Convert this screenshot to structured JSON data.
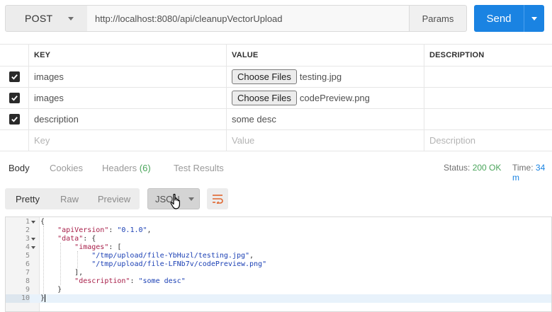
{
  "request": {
    "method": "POST",
    "url": "http://localhost:8080/api/cleanupVectorUpload",
    "params_label": "Params",
    "send_label": "Send"
  },
  "table": {
    "headers": {
      "key": "KEY",
      "value": "VALUE",
      "description": "DESCRIPTION"
    },
    "rows": [
      {
        "checked": true,
        "key": "images",
        "type": "file",
        "button": "Choose Files",
        "filename": "testing.jpg",
        "description": ""
      },
      {
        "checked": true,
        "key": "images",
        "type": "file",
        "button": "Choose Files",
        "filename": "codePreview.png",
        "description": ""
      },
      {
        "checked": true,
        "key": "description",
        "type": "text",
        "value": "some desc",
        "description": ""
      }
    ],
    "placeholders": {
      "key": "Key",
      "value": "Value",
      "description": "Description"
    }
  },
  "response": {
    "tabs": [
      "Body",
      "Cookies",
      "Headers",
      "Test Results"
    ],
    "headers_count": "(6)",
    "status_label": "Status:",
    "status_value": "200 OK",
    "time_label": "Time:",
    "time_value": "34 m"
  },
  "toolbar": {
    "views": [
      "Pretty",
      "Raw",
      "Preview"
    ],
    "format": "JSON"
  },
  "code": {
    "line_numbers": [
      "1",
      "2",
      "3",
      "4",
      "5",
      "6",
      "7",
      "8",
      "9",
      "10"
    ],
    "lines": [
      "{",
      "    \"apiVersion\": \"0.1.0\",",
      "    \"data\": {",
      "        \"images\": [",
      "            \"/tmp/upload/file-YbHuzl/testing.jpg\",",
      "            \"/tmp/upload/file-LFNb7v/codePreview.png\"",
      "        ],",
      "        \"description\": \"some desc\"",
      "    }",
      "}"
    ]
  },
  "colors": {
    "accent": "#1a83e2",
    "status_ok": "#4aa55b",
    "json_key": "#a8204a",
    "json_string": "#1a3fb4"
  }
}
